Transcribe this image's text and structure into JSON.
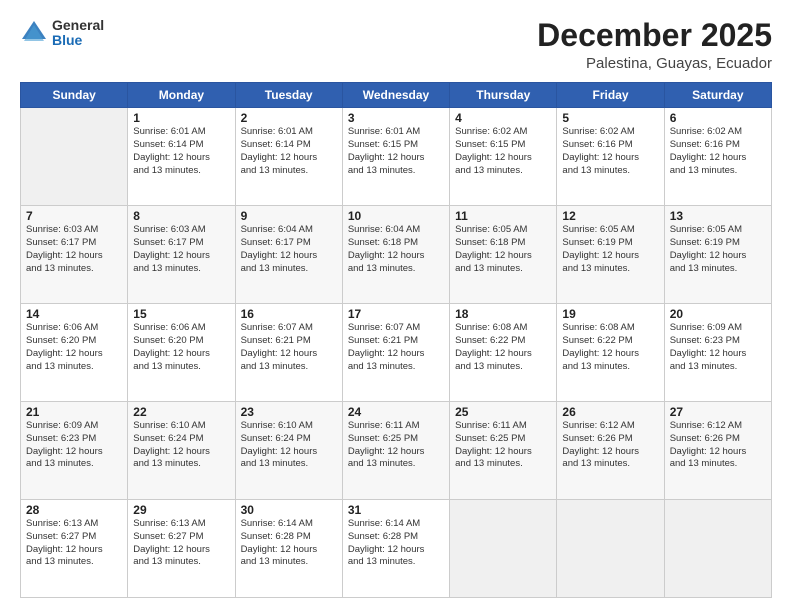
{
  "logo": {
    "general": "General",
    "blue": "Blue"
  },
  "header": {
    "title": "December 2025",
    "subtitle": "Palestina, Guayas, Ecuador"
  },
  "days_of_week": [
    "Sunday",
    "Monday",
    "Tuesday",
    "Wednesday",
    "Thursday",
    "Friday",
    "Saturday"
  ],
  "weeks": [
    [
      {
        "day": "",
        "info": ""
      },
      {
        "day": "1",
        "info": "Sunrise: 6:01 AM\nSunset: 6:14 PM\nDaylight: 12 hours\nand 13 minutes."
      },
      {
        "day": "2",
        "info": "Sunrise: 6:01 AM\nSunset: 6:14 PM\nDaylight: 12 hours\nand 13 minutes."
      },
      {
        "day": "3",
        "info": "Sunrise: 6:01 AM\nSunset: 6:15 PM\nDaylight: 12 hours\nand 13 minutes."
      },
      {
        "day": "4",
        "info": "Sunrise: 6:02 AM\nSunset: 6:15 PM\nDaylight: 12 hours\nand 13 minutes."
      },
      {
        "day": "5",
        "info": "Sunrise: 6:02 AM\nSunset: 6:16 PM\nDaylight: 12 hours\nand 13 minutes."
      },
      {
        "day": "6",
        "info": "Sunrise: 6:02 AM\nSunset: 6:16 PM\nDaylight: 12 hours\nand 13 minutes."
      }
    ],
    [
      {
        "day": "7",
        "info": "Sunrise: 6:03 AM\nSunset: 6:17 PM\nDaylight: 12 hours\nand 13 minutes."
      },
      {
        "day": "8",
        "info": "Sunrise: 6:03 AM\nSunset: 6:17 PM\nDaylight: 12 hours\nand 13 minutes."
      },
      {
        "day": "9",
        "info": "Sunrise: 6:04 AM\nSunset: 6:17 PM\nDaylight: 12 hours\nand 13 minutes."
      },
      {
        "day": "10",
        "info": "Sunrise: 6:04 AM\nSunset: 6:18 PM\nDaylight: 12 hours\nand 13 minutes."
      },
      {
        "day": "11",
        "info": "Sunrise: 6:05 AM\nSunset: 6:18 PM\nDaylight: 12 hours\nand 13 minutes."
      },
      {
        "day": "12",
        "info": "Sunrise: 6:05 AM\nSunset: 6:19 PM\nDaylight: 12 hours\nand 13 minutes."
      },
      {
        "day": "13",
        "info": "Sunrise: 6:05 AM\nSunset: 6:19 PM\nDaylight: 12 hours\nand 13 minutes."
      }
    ],
    [
      {
        "day": "14",
        "info": "Sunrise: 6:06 AM\nSunset: 6:20 PM\nDaylight: 12 hours\nand 13 minutes."
      },
      {
        "day": "15",
        "info": "Sunrise: 6:06 AM\nSunset: 6:20 PM\nDaylight: 12 hours\nand 13 minutes."
      },
      {
        "day": "16",
        "info": "Sunrise: 6:07 AM\nSunset: 6:21 PM\nDaylight: 12 hours\nand 13 minutes."
      },
      {
        "day": "17",
        "info": "Sunrise: 6:07 AM\nSunset: 6:21 PM\nDaylight: 12 hours\nand 13 minutes."
      },
      {
        "day": "18",
        "info": "Sunrise: 6:08 AM\nSunset: 6:22 PM\nDaylight: 12 hours\nand 13 minutes."
      },
      {
        "day": "19",
        "info": "Sunrise: 6:08 AM\nSunset: 6:22 PM\nDaylight: 12 hours\nand 13 minutes."
      },
      {
        "day": "20",
        "info": "Sunrise: 6:09 AM\nSunset: 6:23 PM\nDaylight: 12 hours\nand 13 minutes."
      }
    ],
    [
      {
        "day": "21",
        "info": "Sunrise: 6:09 AM\nSunset: 6:23 PM\nDaylight: 12 hours\nand 13 minutes."
      },
      {
        "day": "22",
        "info": "Sunrise: 6:10 AM\nSunset: 6:24 PM\nDaylight: 12 hours\nand 13 minutes."
      },
      {
        "day": "23",
        "info": "Sunrise: 6:10 AM\nSunset: 6:24 PM\nDaylight: 12 hours\nand 13 minutes."
      },
      {
        "day": "24",
        "info": "Sunrise: 6:11 AM\nSunset: 6:25 PM\nDaylight: 12 hours\nand 13 minutes."
      },
      {
        "day": "25",
        "info": "Sunrise: 6:11 AM\nSunset: 6:25 PM\nDaylight: 12 hours\nand 13 minutes."
      },
      {
        "day": "26",
        "info": "Sunrise: 6:12 AM\nSunset: 6:26 PM\nDaylight: 12 hours\nand 13 minutes."
      },
      {
        "day": "27",
        "info": "Sunrise: 6:12 AM\nSunset: 6:26 PM\nDaylight: 12 hours\nand 13 minutes."
      }
    ],
    [
      {
        "day": "28",
        "info": "Sunrise: 6:13 AM\nSunset: 6:27 PM\nDaylight: 12 hours\nand 13 minutes."
      },
      {
        "day": "29",
        "info": "Sunrise: 6:13 AM\nSunset: 6:27 PM\nDaylight: 12 hours\nand 13 minutes."
      },
      {
        "day": "30",
        "info": "Sunrise: 6:14 AM\nSunset: 6:28 PM\nDaylight: 12 hours\nand 13 minutes."
      },
      {
        "day": "31",
        "info": "Sunrise: 6:14 AM\nSunset: 6:28 PM\nDaylight: 12 hours\nand 13 minutes."
      },
      {
        "day": "",
        "info": ""
      },
      {
        "day": "",
        "info": ""
      },
      {
        "day": "",
        "info": ""
      }
    ]
  ]
}
